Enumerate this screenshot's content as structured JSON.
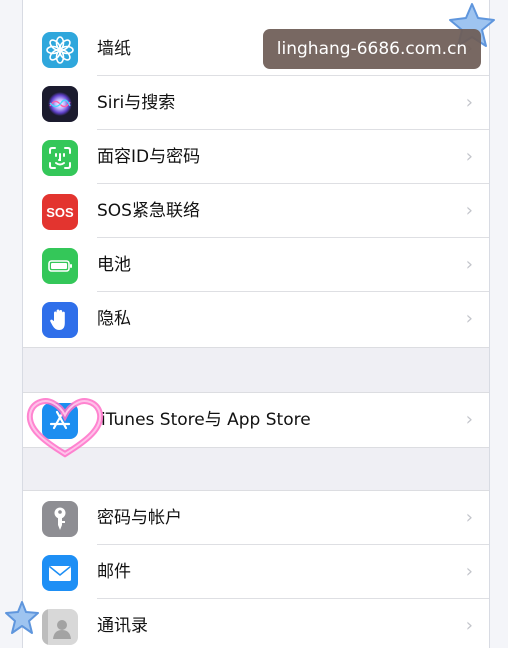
{
  "watermark": {
    "text": "linghang-6686.com.cn"
  },
  "settings": {
    "group1": [
      {
        "label": "墙纸",
        "icon": "wallpaper-flower-icon",
        "color": "#2fa7dc"
      },
      {
        "label": "Siri与搜索",
        "icon": "siri-icon",
        "color": "#1b1b2e"
      },
      {
        "label": "面容ID与密码",
        "icon": "face-id-icon",
        "color": "#34c759"
      },
      {
        "label": "SOS紧急联络",
        "icon": "sos-icon",
        "color": "#e3342f",
        "icon_text": "SOS"
      },
      {
        "label": "电池",
        "icon": "battery-icon",
        "color": "#34c759"
      },
      {
        "label": "隐私",
        "icon": "privacy-hand-icon",
        "color": "#2f6fea"
      }
    ],
    "group2": [
      {
        "label": "iTunes Store与 App Store",
        "icon": "app-store-icon",
        "color": "#1c8ef0"
      }
    ],
    "group3": [
      {
        "label": "密码与帐户",
        "icon": "key-icon",
        "color": "#8e8e93"
      },
      {
        "label": "邮件",
        "icon": "mail-icon",
        "color": "#1e8ff5"
      },
      {
        "label": "通讯录",
        "icon": "contacts-icon",
        "color": "#d8d8d8"
      }
    ],
    "chevron": "›"
  }
}
